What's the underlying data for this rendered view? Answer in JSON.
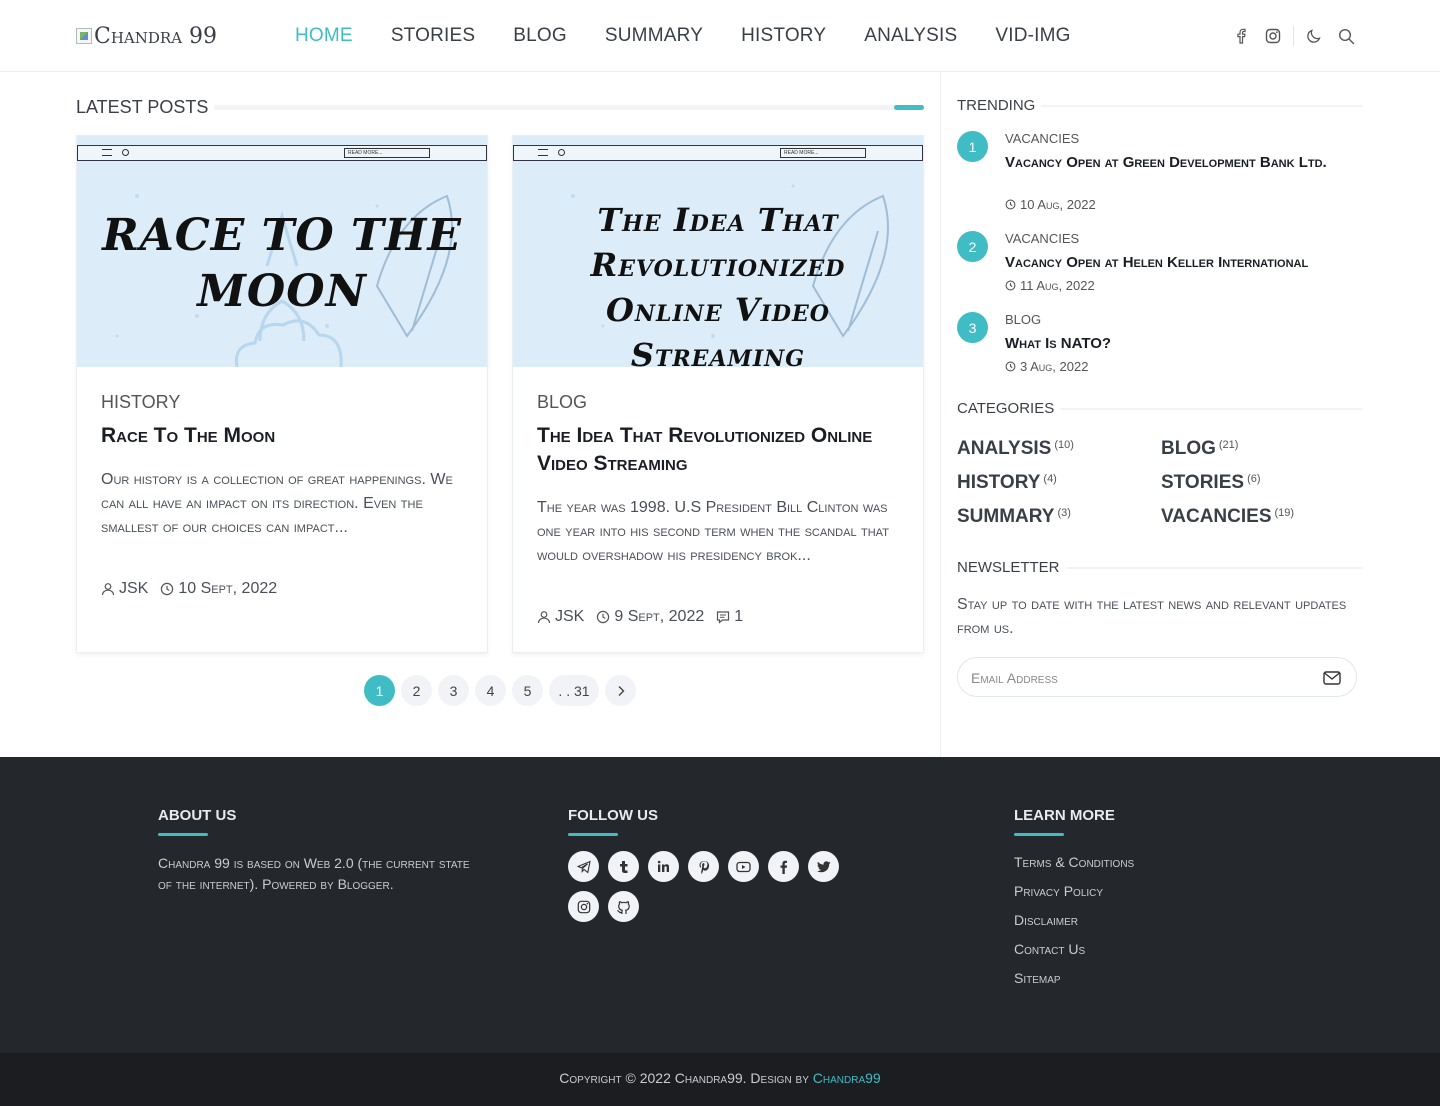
{
  "header": {
    "logo_alt": "Chandra 99",
    "nav": [
      "Home",
      "Stories",
      "Blog",
      "Summary",
      "History",
      "Analysis",
      "Vid-Img"
    ],
    "active_nav": "Home",
    "icons": [
      "facebook-icon",
      "instagram-icon",
      "moon-icon",
      "search-icon"
    ]
  },
  "latest": {
    "title": "Latest Posts",
    "posts": [
      {
        "image_text": "RACE TO THE MOON",
        "search_placeholder": "READ MORE...",
        "category": "History",
        "title": "Race To The Moon",
        "snippet": "Our history is a collection of great happenings. We can all have an impact on its direction. Even the smallest of our choices can impact...",
        "author": "JSK",
        "date": "10 Sept, 2022",
        "comments": ""
      },
      {
        "image_text": "The Idea That Revolutionized Online Video Streaming",
        "search_placeholder": "READ MORE...",
        "category": "Blog",
        "title": "The Idea That Revolutionized Online Video Streaming",
        "snippet": "The year was 1998. U.S President Bill Clinton was one year into his second term when the scandal that would overshadow his presidency brok...",
        "author": "JSK",
        "date": "9 Sept, 2022",
        "comments": "1"
      }
    ],
    "pager": [
      "1",
      "2",
      "3",
      "4",
      "5",
      ". . 31"
    ],
    "active_page": "1"
  },
  "sidebar": {
    "trending_title": "Trending",
    "trending": [
      {
        "num": "1",
        "category": "Vacancies",
        "title": "Vacancy Open at Green Development Bank Ltd.",
        "date": "10 Aug, 2022"
      },
      {
        "num": "2",
        "category": "Vacancies",
        "title": "Vacancy Open at Helen Keller International",
        "date": "11 Aug, 2022"
      },
      {
        "num": "3",
        "category": "Blog",
        "title": "What Is NATO?",
        "date": "3 Aug, 2022"
      }
    ],
    "categories_title": "Categories",
    "categories": [
      {
        "name": "Analysis",
        "count": "(10)"
      },
      {
        "name": "Blog",
        "count": "(21)"
      },
      {
        "name": "History",
        "count": "(4)"
      },
      {
        "name": "Stories",
        "count": "(6)"
      },
      {
        "name": "Summary",
        "count": "(3)"
      },
      {
        "name": "Vacancies",
        "count": "(19)"
      }
    ],
    "newsletter_title": "Newsletter",
    "newsletter_text": "Stay up to date with the latest news and relevant updates from us.",
    "email_placeholder": "Email Address"
  },
  "footer": {
    "about_title": "About Us",
    "about_text": "Chandra 99 is based on Web 2.0 (the current state of the internet). Powered by Blogger.",
    "follow_title": "Follow Us",
    "social_icons": [
      "telegram-icon",
      "tumblr-icon",
      "linkedin-icon",
      "pinterest-icon",
      "youtube-icon",
      "facebook-icon",
      "twitter-icon",
      "instagram-icon",
      "github-icon"
    ],
    "learn_title": "Learn More",
    "links": [
      "Terms & Conditions",
      "Privacy Policy",
      "Disclaimer",
      "Contact Us",
      "Sitemap"
    ],
    "copyright_prefix": "Copyright © 2022 Chandra99. Design by ",
    "copyright_link": "Chandra99"
  },
  "colors": {
    "accent": "#3fbcc4",
    "footer_bg": "#24272c",
    "bottom_bg": "#1b1d21"
  }
}
